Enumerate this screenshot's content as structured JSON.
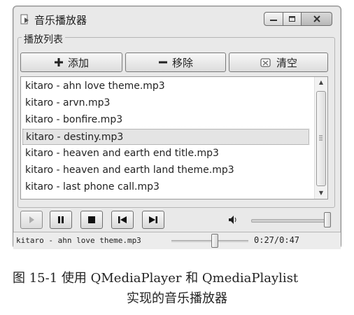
{
  "window": {
    "title": "音乐播放器"
  },
  "playlist": {
    "group_title": "播放列表",
    "buttons": {
      "add": "添加",
      "remove": "移除",
      "clear": "清空"
    },
    "items": [
      "kitaro - ahn love theme.mp3",
      "kitaro - arvn.mp3",
      "kitaro - bonfire.mp3",
      "kitaro - destiny.mp3",
      "kitaro - heaven and earth end title.mp3",
      "kitaro - heaven and earth land theme.mp3",
      "kitaro - last phone call.mp3"
    ],
    "selected_index": 3
  },
  "controls": {
    "volume_level": 1.0,
    "position_fraction": 0.574
  },
  "status": {
    "current_file": "kitaro - ahn love theme.mp3",
    "time": "0:27/0:47"
  },
  "caption": {
    "line1": "图 15-1   使用 QMediaPlayer 和 QmediaPlaylist",
    "line2": "实现的音乐播放器"
  },
  "colors": {
    "window_bg": "#e9e9e9",
    "selection_bg": "#e4e4e4"
  }
}
